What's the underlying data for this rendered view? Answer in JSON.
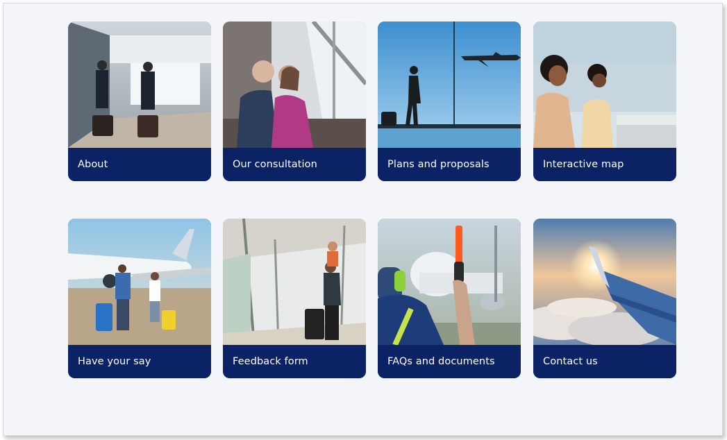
{
  "cards": [
    {
      "label": "About",
      "photo": "terminal-pilots-icon"
    },
    {
      "label": "Our consultation",
      "photo": "couple-seated-icon"
    },
    {
      "label": "Plans and proposals",
      "photo": "window-plane-traveller-icon"
    },
    {
      "label": "Interactive map",
      "photo": "mother-child-window-icon"
    },
    {
      "label": "Have your say",
      "photo": "family-apron-plane-icon"
    },
    {
      "label": "Feedback form",
      "photo": "father-child-walkway-icon"
    },
    {
      "label": "FAQs and documents",
      "photo": "marshaller-wand-icon"
    },
    {
      "label": "Contact us",
      "photo": "wing-above-clouds-icon"
    }
  ],
  "colors": {
    "card_label_bg": "#0b2265",
    "page_bg": "#f3f5f9",
    "label_text": "#ffffff"
  }
}
